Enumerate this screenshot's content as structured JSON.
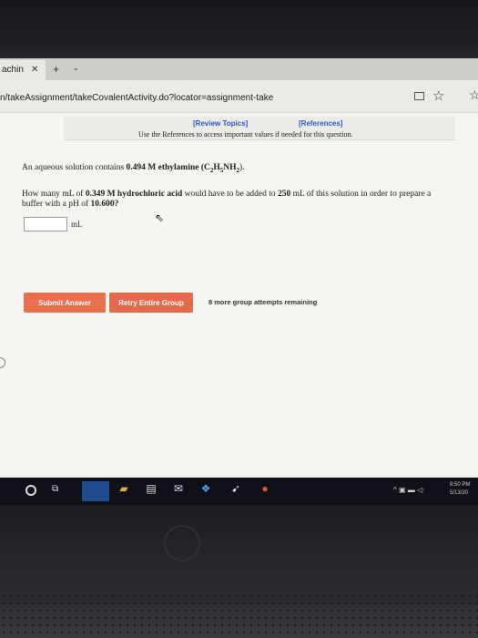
{
  "browser": {
    "tab_title": "achin",
    "tab_close": "✕",
    "new_tab": "+",
    "tab_menu": "⌄",
    "url": "n/takeAssignment/takeCovalentActivity.do?locator=assignment-take",
    "star": "☆",
    "fav": "☆"
  },
  "header": {
    "review_topics": "[Review Topics]",
    "references": "[References]",
    "use_references": "Use the References to access important values if needed for this question."
  },
  "question": {
    "line1_pre": "An aqueous solution contains ",
    "line1_conc": "0.494 M ethylamine",
    "line1_formula_a": " (C",
    "sub1": "2",
    "line1_formula_b": "H",
    "sub2": "5",
    "line1_formula_c": "NH",
    "sub3": "2",
    "line1_end": ").",
    "line2_pre": "How many mL of ",
    "line2_conc": "0.349 M hydrochloric acid",
    "line2_mid": " would have to be added to ",
    "line2_vol": "250",
    "line2_post": " mL of this solution in order to prepare a",
    "line3_pre": "buffer with a pH of ",
    "line3_ph": "10.600",
    "line3_end": "?"
  },
  "answer": {
    "value": "",
    "unit": "mL"
  },
  "actions": {
    "submit_label": "Submit Answer",
    "retry_label": "Retry Entire Group",
    "attempts_text": "8 more group attempts remaining"
  },
  "taskbar": {
    "tray": "^ ▣ ▬ ◁ᐧ",
    "time": "8:50 PM",
    "date": "5/13/20"
  },
  "colors": {
    "link": "#2b57c9",
    "button": "#e8704f"
  }
}
